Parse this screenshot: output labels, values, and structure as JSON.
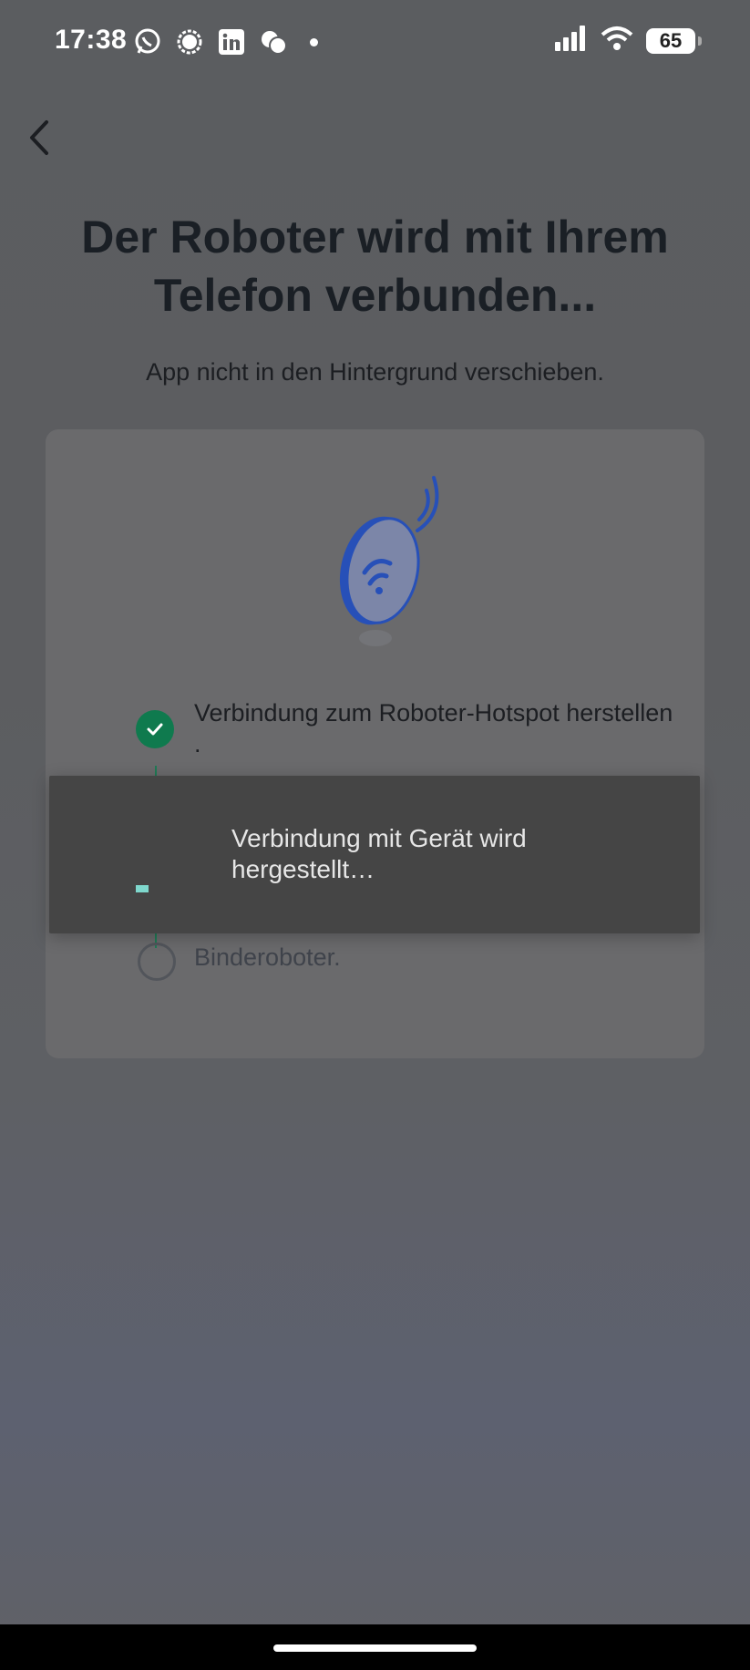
{
  "status_bar": {
    "time": "17:38",
    "notification_icons": [
      "whatsapp-icon",
      "signal-icon",
      "linkedin-icon",
      "bubbles-icon"
    ],
    "battery_level": "65"
  },
  "header": {
    "title_line1": "Der Roboter wird mit Ihrem",
    "title_line2": "Telefon verbunden...",
    "subtitle": "App nicht in den Hintergrund verschieben."
  },
  "steps": [
    {
      "label": "Verbindung zum Roboter-Hotspot herstellen",
      "suffix": ".",
      "state": "done"
    },
    {
      "label": "Binderoboter.",
      "state": "pending"
    }
  ],
  "toast": {
    "message": "Verbindung mit Gerät wird hergestellt…"
  },
  "colors": {
    "accent_green": "#0f7a4e",
    "spinner_teal": "#7fd8cd",
    "illustration_blue": "#2750b8"
  }
}
